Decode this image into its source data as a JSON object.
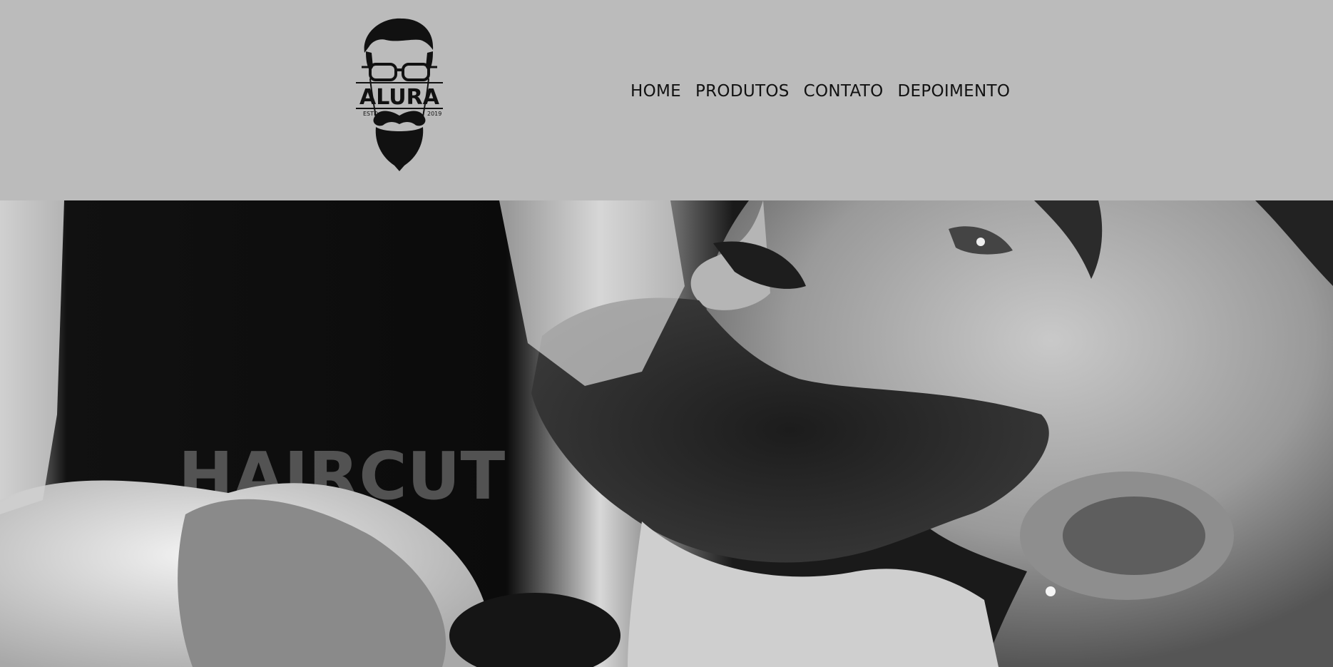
{
  "logo": {
    "brand": "ALURA",
    "estd_label": "ESTD",
    "year": "2019"
  },
  "nav": {
    "items": [
      {
        "label": "HOME"
      },
      {
        "label": "PRODUTOS"
      },
      {
        "label": "CONTATO"
      },
      {
        "label": "DEPOIMENTO"
      }
    ]
  },
  "banner": {
    "image": "bearded-man-grooming-photo",
    "background_text": "HAIRCUT"
  },
  "colors": {
    "header_bg": "#bbbbbb",
    "nav_text": "#111111"
  }
}
